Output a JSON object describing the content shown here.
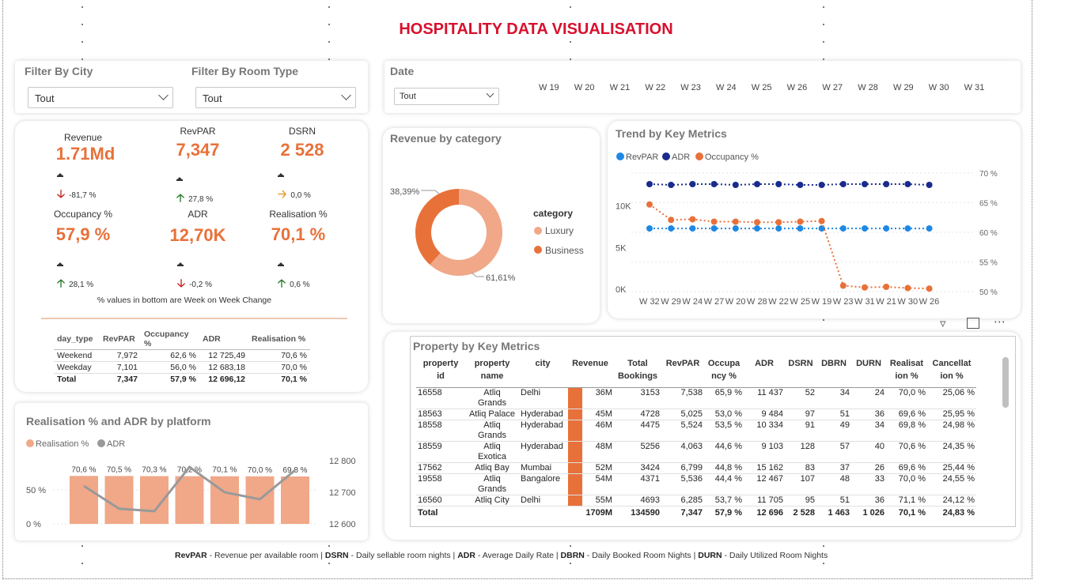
{
  "page": {
    "title": "HOSPITALITY DATA VISUALISATION"
  },
  "filters": {
    "city_label": "Filter By City",
    "city_value": "Tout",
    "room_label": "Filter By Room Type",
    "room_value": "Tout",
    "date_label": "Date",
    "date_value": "Tout",
    "weeks": [
      "W 19",
      "W 20",
      "W 21",
      "W 22",
      "W 23",
      "W 24",
      "W 25",
      "W 26",
      "W 27",
      "W 28",
      "W 29",
      "W 30",
      "W 31"
    ]
  },
  "kpis": [
    {
      "label": "Revenue",
      "value": "1.71Md",
      "change": "-81,7 %",
      "dir": "down"
    },
    {
      "label": "RevPAR",
      "value": "7,347",
      "change": "27,8 %",
      "dir": "up"
    },
    {
      "label": "DSRN",
      "value": "2 528",
      "change": "0,0 %",
      "dir": "flat"
    },
    {
      "label": "Occupancy %",
      "value": "57,9 %",
      "change": "28,1 %",
      "dir": "up"
    },
    {
      "label": "ADR",
      "value": "12,70K",
      "change": "-0,2 %",
      "dir": "down"
    },
    {
      "label": "Realisation %",
      "value": "70,1 %",
      "change": "0,6 %",
      "dir": "up"
    }
  ],
  "kpi_note": "% values in bottom are Week on Week Change",
  "day_type_table": {
    "headers": [
      "day_type",
      "RevPAR",
      "Occupancy %",
      "ADR",
      "Realisation %"
    ],
    "rows": [
      [
        "Weekend",
        "7,972",
        "62,6 %",
        "12 725,49",
        "70,6 %"
      ],
      [
        "Weekday",
        "7,101",
        "56,0 %",
        "12 683,18",
        "70,0 %"
      ]
    ],
    "total": [
      "Total",
      "7,347",
      "57,9 %",
      "12 696,12",
      "70,1 %"
    ]
  },
  "colors": {
    "orange": "#e8713a",
    "light_orange": "#f0a888",
    "navy": "#1a2b8c",
    "blue": "#1e88e5",
    "red": "#d8102d"
  },
  "revenue_by_category": {
    "title": "Revenue by category",
    "legend_title": "category",
    "chart_data": {
      "type": "pie",
      "categories": [
        "Luxury",
        "Business"
      ],
      "values": [
        61.61,
        38.39
      ],
      "labels": [
        "61,61%",
        "38,39%"
      ]
    }
  },
  "trend": {
    "title": "Trend by Key Metrics",
    "legend": [
      "RevPAR",
      "ADR",
      "Occupancy %"
    ],
    "chart_data": {
      "type": "line",
      "x": [
        "W 32",
        "W 29",
        "W 24",
        "W 27",
        "W 20",
        "W 28",
        "W 22",
        "W 25",
        "W 19",
        "W 23",
        "W 31",
        "W 21",
        "W 30",
        "W 26"
      ],
      "series": [
        {
          "name": "RevPAR",
          "axis": "left",
          "values": [
            7300,
            7300,
            7300,
            7300,
            7300,
            7300,
            7300,
            7300,
            7300,
            7300,
            7300,
            7300,
            7300,
            7300
          ]
        },
        {
          "name": "ADR",
          "axis": "left",
          "values": [
            12700,
            12690,
            12700,
            12700,
            12690,
            12700,
            12700,
            12690,
            12690,
            12700,
            12700,
            12700,
            12700,
            12690
          ]
        },
        {
          "name": "Occupancy %",
          "axis": "right",
          "values": [
            64.7,
            62.1,
            62.2,
            61.8,
            61.8,
            61.7,
            61.7,
            61.8,
            61.9,
            51.0,
            50.7,
            50.8,
            50.6,
            50.5
          ]
        }
      ],
      "left_ticks": [
        "0K",
        "5K",
        "10K"
      ],
      "right_ticks": [
        "50 %",
        "55 %",
        "60 %",
        "65 %",
        "70 %"
      ],
      "ylim_left": [
        0,
        15000
      ],
      "ylim_right": [
        50,
        70
      ]
    }
  },
  "platform": {
    "title": "Realisation % and ADR by platform",
    "legend": [
      "Realisation %",
      "ADR"
    ],
    "chart_data": {
      "type": "bar",
      "series": [
        {
          "name": "Realisation %",
          "values": [
            70.6,
            70.5,
            70.3,
            70.2,
            70.1,
            70.0,
            69.8
          ],
          "labels": [
            "70,6 %",
            "70,5 %",
            "70,3 %",
            "70,2 %",
            "70,1 %",
            "70,0 %",
            "69,8 %"
          ]
        },
        {
          "name": "ADR",
          "values": [
            12720,
            12648,
            12640,
            12780,
            12700,
            12678,
            12770
          ]
        }
      ],
      "left_ticks": [
        "0 %",
        "50 %"
      ],
      "right_ticks": [
        "12 600",
        "12 700",
        "12 800"
      ],
      "ylim_left": [
        0,
        100
      ],
      "ylim_right": [
        12600,
        12800
      ]
    }
  },
  "property": {
    "title": "Property by Key Metrics",
    "headers": [
      [
        "property",
        "id"
      ],
      [
        "property",
        "name"
      ],
      [
        "city"
      ],
      [
        "Revenue"
      ],
      [
        "Total",
        "Bookings"
      ],
      [
        "RevPAR"
      ],
      [
        "Occupa",
        "ncy %"
      ],
      [
        "ADR"
      ],
      [
        "DSRN"
      ],
      [
        "DBRN"
      ],
      [
        "DURN"
      ],
      [
        "Realisat",
        "ion %"
      ],
      [
        "Cancellat",
        "ion %"
      ]
    ],
    "rows": [
      [
        "16558",
        [
          "Atliq",
          "Grands"
        ],
        "Delhi",
        "36M",
        "3153",
        "7,538",
        "65,9 %",
        "11 437",
        "52",
        "34",
        "24",
        "70,0 %",
        "25,06 %"
      ],
      [
        "18563",
        [
          "Atliq Palace"
        ],
        "Hyderabad",
        "45M",
        "4728",
        "5,025",
        "53,0 %",
        "9 484",
        "97",
        "51",
        "36",
        "69,6 %",
        "25,95 %"
      ],
      [
        "18558",
        [
          "Atliq",
          "Grands"
        ],
        "Hyderabad",
        "46M",
        "4475",
        "5,524",
        "53,5 %",
        "10 334",
        "91",
        "49",
        "34",
        "69,8 %",
        "24,98 %"
      ],
      [
        "18559",
        [
          "Atliq",
          "Exotica"
        ],
        "Hyderabad",
        "48M",
        "5256",
        "4,063",
        "44,6 %",
        "9 103",
        "128",
        "57",
        "40",
        "70,6 %",
        "24,35 %"
      ],
      [
        "17562",
        [
          "Atliq Bay"
        ],
        "Mumbai",
        "52M",
        "3424",
        "6,799",
        "44,8 %",
        "15 162",
        "83",
        "37",
        "26",
        "69,6 %",
        "25,44 %"
      ],
      [
        "19558",
        [
          "Atliq",
          "Grands"
        ],
        "Bangalore",
        "54M",
        "4371",
        "5,536",
        "44,4 %",
        "12 467",
        "107",
        "48",
        "33",
        "70,0 %",
        "24,55 %"
      ],
      [
        "16560",
        [
          "Atliq City"
        ],
        "Delhi",
        "55M",
        "4693",
        "6,285",
        "53,7 %",
        "11 705",
        "95",
        "51",
        "36",
        "71,1 %",
        "24,12 %"
      ]
    ],
    "total": [
      "Total",
      "",
      "",
      "1709M",
      "134590",
      "7,347",
      "57,9 %",
      "12 696",
      "2 528",
      "1 463",
      "1 026",
      "70,1 %",
      "24,83 %"
    ]
  },
  "footer": [
    {
      "k": "RevPAR",
      "v": " - Revenue per available room | "
    },
    {
      "k": "DSRN",
      "v": " - Daily sellable room nights | "
    },
    {
      "k": "ADR",
      "v": " - Average Daily Rate | "
    },
    {
      "k": "DBRN",
      "v": " - Daily Booked Room Nights | "
    },
    {
      "k": "DURN",
      "v": " - Daily Utilized Room Nights"
    }
  ]
}
